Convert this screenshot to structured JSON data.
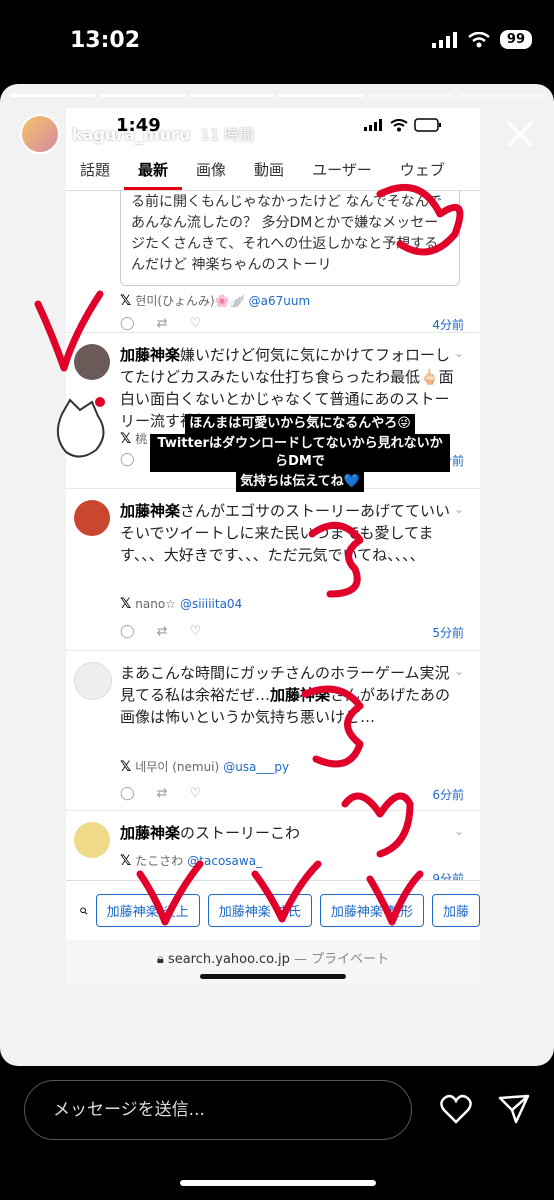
{
  "status_bar": {
    "time": "13:02",
    "battery": "99"
  },
  "story": {
    "username": "kagura_muru",
    "time_ago": "11 時間"
  },
  "inner": {
    "time": "1:49",
    "tabs": [
      "話題",
      "最新",
      "画像",
      "動画",
      "ユーザー",
      "ウェブ"
    ],
    "active_tab": "最新",
    "tweets": [
      {
        "quote_text": "る前に開くもんじゃなかったけど なんでそなんであんなん流したの？ 多分DMとかで嫌なメッセージたくさんきて、それへの仕返しかなと予想するんだけど 神楽ちゃんのストーリ",
        "user": "현미(ひょんみ)🌸🪽",
        "handle": "@a67uum",
        "time": "4分前"
      },
      {
        "text_prefix": "加藤神楽",
        "text": "嫌いだけど何気に気にかけてフォローしてたけどカスみたいな仕打ち食らったわ最低🖕🏻面白い面白くないとかじゃなくて普通にあのストーリー流す神経おかしいよ",
        "user": "桃",
        "time": "5分前"
      },
      {
        "text_prefix": "加藤神楽",
        "text": "さんがエゴサのストーリーあげてていいそいでツイートしに来た民いつまでも愛してます、、、大好きです、、、ただ元気でいてね、、、、",
        "user": "nano☆",
        "handle": "@siiiiita04",
        "time": "5分前"
      },
      {
        "text_a": "まあこんな時間にガッチさんのホラーゲーム実況見てる私は余裕だぜ…",
        "text_bold": "加藤神楽",
        "text_b": "さんがあげたあの画像は怖いというか気持ち悪いけど…",
        "user": "네무이 (nemui)",
        "handle": "@usa___py",
        "time": "6分前"
      },
      {
        "text_prefix": "加藤神楽",
        "text": "のストーリーこわ",
        "user": "たこさわ",
        "handle": "@tacosawa_",
        "time": "9分前"
      }
    ],
    "suggestions": [
      "加藤神楽 炎上",
      "加藤神楽 彼氏",
      "加藤神楽 整形",
      "加藤"
    ],
    "url": "search.yahoo.co.jp",
    "url_suffix": "— プライベート"
  },
  "overlay_lines": [
    "ほんまは可愛いから気になるんやろ😜",
    "Twitterはダウンロードしてないから見れないからDMで",
    "気持ちは伝えてね💙"
  ],
  "bottom": {
    "message_placeholder": "メッセージを送信..."
  },
  "colors": {
    "accent_red": "#e0002a",
    "link_blue": "#1d68c9",
    "tab_active": "#e60012"
  }
}
